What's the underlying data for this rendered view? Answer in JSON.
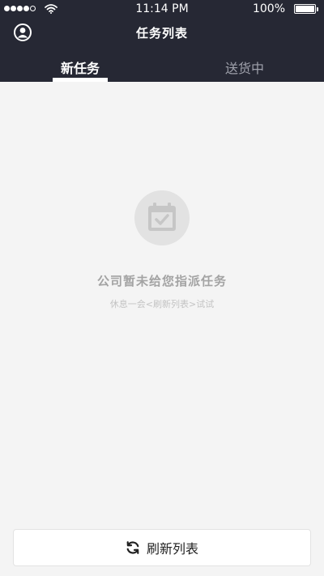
{
  "status_bar": {
    "time": "11:14 PM",
    "battery": "100%"
  },
  "header": {
    "title": "任务列表"
  },
  "tabs": [
    {
      "label": "新任务",
      "active": true
    },
    {
      "label": "送货中",
      "active": false
    }
  ],
  "empty_state": {
    "title": "公司暂未给您指派任务",
    "hint": "休息一会<刷新列表>试试"
  },
  "refresh_button": {
    "label": "刷新列表"
  },
  "icons": [
    "signal-icon",
    "wifi-icon",
    "battery-icon",
    "user-avatar-icon",
    "calendar-check-icon",
    "refresh-icon"
  ],
  "colors": {
    "header_bg": "#262834",
    "page_bg": "#f4f4f4",
    "inactive_tab": "#9fa1ab",
    "empty_title": "#a3a3a3",
    "empty_hint": "#c3c3c3"
  }
}
